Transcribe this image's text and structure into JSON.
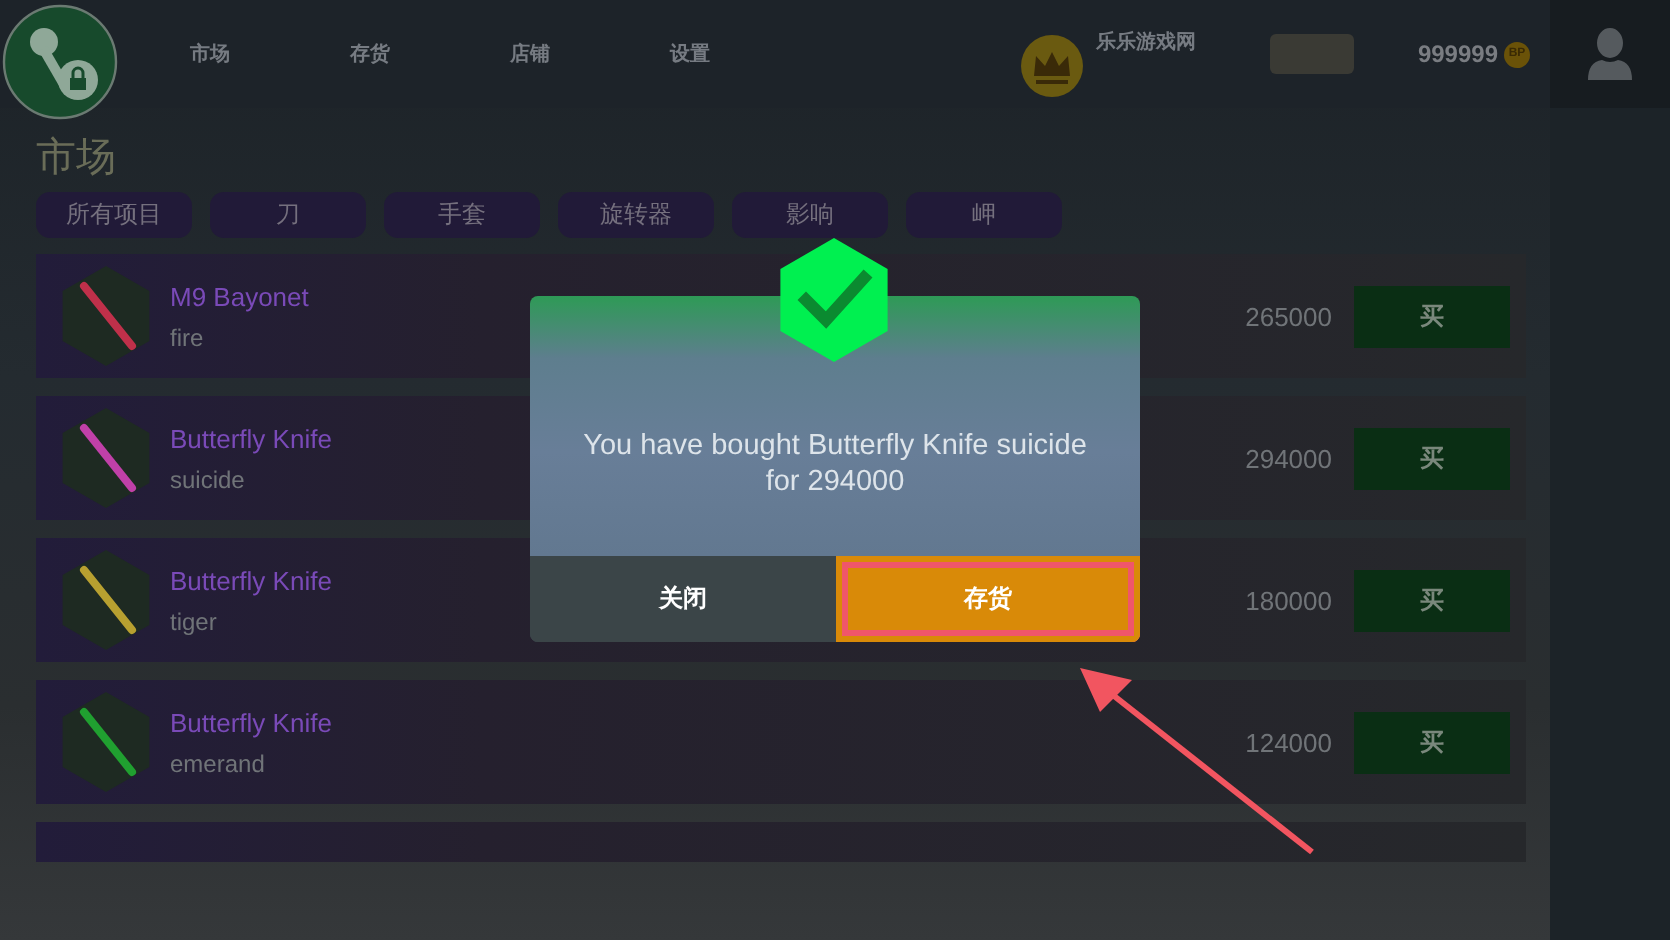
{
  "nav": {
    "items": [
      "市场",
      "存货",
      "店铺",
      "设置"
    ]
  },
  "user": {
    "name": "乐乐游戏网",
    "coins": "999999",
    "coin_symbol": "BP"
  },
  "market": {
    "title": "市场",
    "filters": [
      "所有项目",
      "刀",
      "手套",
      "旋转器",
      "影响",
      "岬"
    ],
    "items": [
      {
        "name": "M9 Bayonet",
        "skin": "fire",
        "price": "265000",
        "buy_label": "买",
        "color": "#c0304a"
      },
      {
        "name": "Butterfly Knife",
        "skin": "suicide",
        "price": "294000",
        "buy_label": "买",
        "color": "#c040a8"
      },
      {
        "name": "Butterfly Knife",
        "skin": "tiger",
        "price": "180000",
        "buy_label": "买",
        "color": "#b8a030"
      },
      {
        "name": "Butterfly Knife",
        "skin": "emerand",
        "price": "124000",
        "buy_label": "买",
        "color": "#20a030"
      }
    ]
  },
  "dialog": {
    "message": "You have bought Butterfly Knife suicide for 294000",
    "buttons": [
      {
        "label": "关闭",
        "kind": "close",
        "highlighted": false
      },
      {
        "label": "存货",
        "kind": "inventory",
        "highlighted": true
      }
    ]
  }
}
